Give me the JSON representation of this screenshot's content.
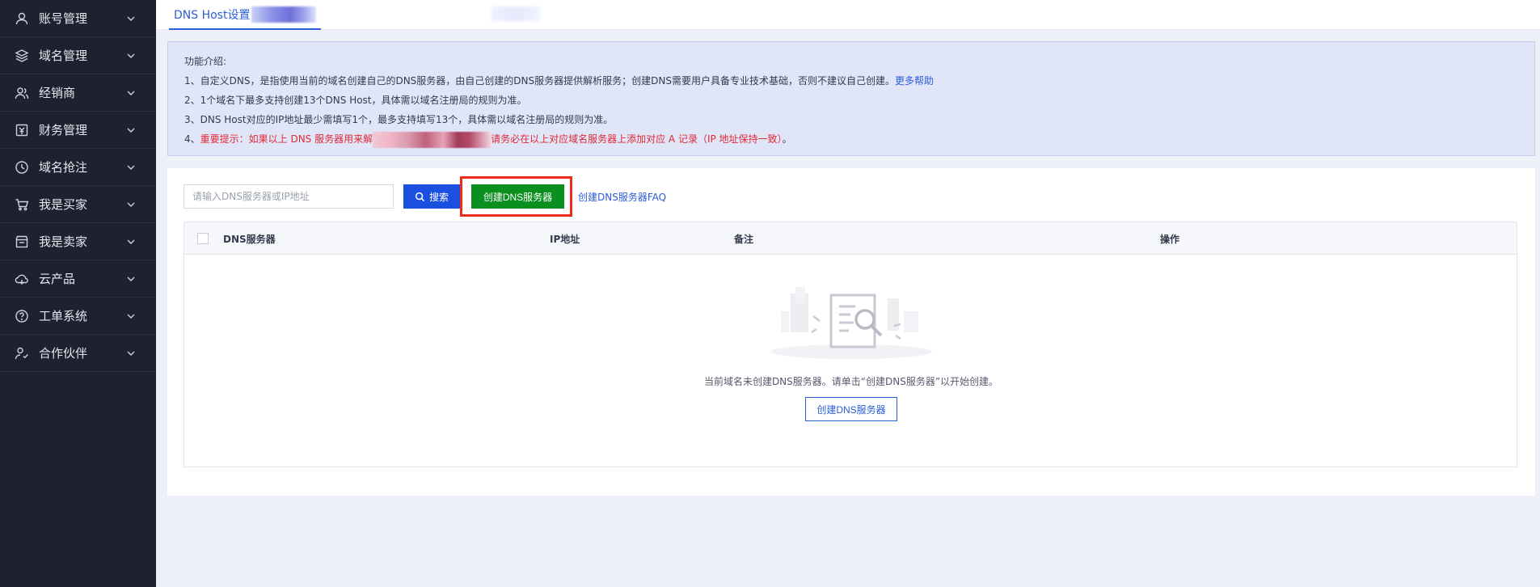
{
  "sidebar": {
    "items": [
      {
        "label": "账号管理",
        "icon": "user-icon"
      },
      {
        "label": "域名管理",
        "icon": "layers-icon"
      },
      {
        "label": "经销商",
        "icon": "users-icon"
      },
      {
        "label": "财务管理",
        "icon": "finance-icon"
      },
      {
        "label": "域名抢注",
        "icon": "clock-icon"
      },
      {
        "label": "我是买家",
        "icon": "cart-icon"
      },
      {
        "label": "我是卖家",
        "icon": "store-icon"
      },
      {
        "label": "云产品",
        "icon": "cloud-icon"
      },
      {
        "label": "工单系统",
        "icon": "help-icon"
      },
      {
        "label": "合作伙伴",
        "icon": "partner-icon"
      }
    ]
  },
  "tabs": {
    "active_label": "DNS Host设置"
  },
  "notice": {
    "title": "功能介绍:",
    "line1": "1、自定义DNS，是指使用当前的域名创建自己的DNS服务器，由自己创建的DNS服务器提供解析服务；创建DNS需要用户具备专业技术基础，否则不建议自己创建。",
    "line1_link": "更多帮助",
    "line2": "2、1个域名下最多支持创建13个DNS Host，具体需以域名注册局的规则为准。",
    "line3": "3、DNS Host对应的IP地址最少需填写1个，最多支持填写13个，具体需以域名注册局的规则为准。",
    "line4_prefix": "4、",
    "line4_warn_a": "重要提示：如果以上 DNS 服务器用来解",
    "line4_warn_b": "请务必在以上对应域名服务器上添加对应 A 记录（IP 地址保持一致）",
    "line4_suffix": "。"
  },
  "toolbar": {
    "search_placeholder": "请输入DNS服务器或IP地址",
    "search_value": "",
    "search_label": "搜索",
    "create_label": "创建DNS服务器",
    "faq_label": "创建DNS服务器FAQ"
  },
  "table": {
    "columns": [
      "DNS服务器",
      "IP地址",
      "备注",
      "操作"
    ],
    "empty_text": "当前域名未创建DNS服务器。请单击“创建DNS服务器”以开始创建。",
    "empty_button": "创建DNS服务器"
  },
  "colors": {
    "sidebar_bg": "#1d2130",
    "accent": "#2b5cd9",
    "search_button": "#1a4fe0",
    "create_button": "#0b8f1f",
    "highlight": "#ee2a1a",
    "warning": "#e02a36",
    "notice_bg": "#e1e5f8"
  }
}
